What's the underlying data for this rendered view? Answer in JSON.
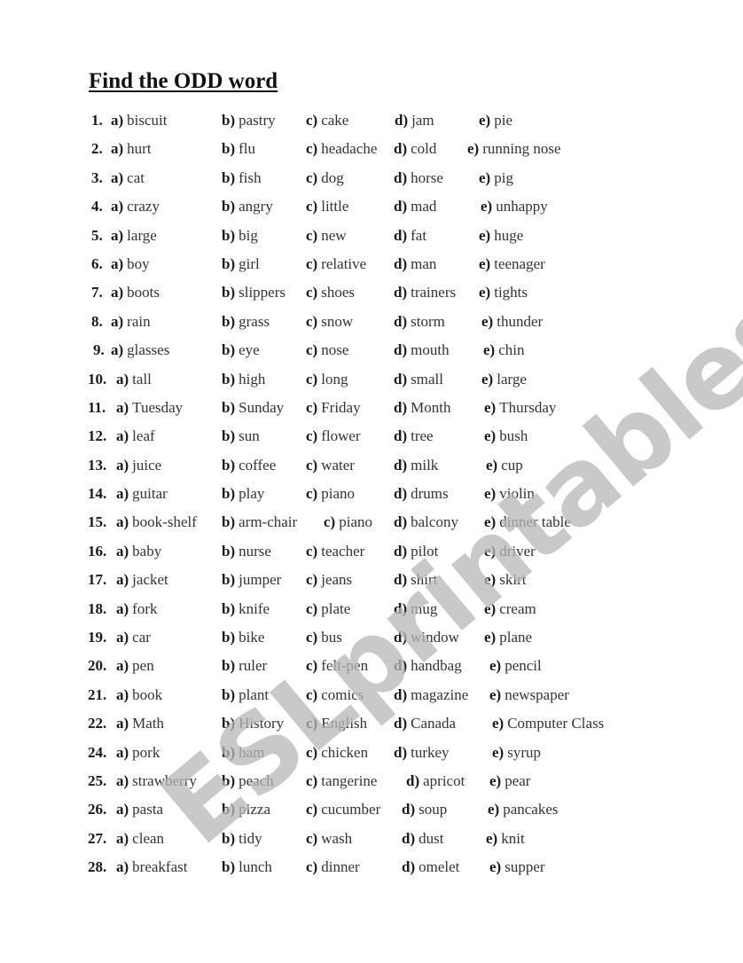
{
  "title": "Find the ODD word",
  "watermark": "ESLprintables.com",
  "colors": {
    "text": "#1a1a1a",
    "watermark": "#b8b8b8",
    "background": "#ffffff"
  },
  "letters": [
    "a)",
    "b)",
    "c)",
    "d)",
    "e)"
  ],
  "items": [
    {
      "num": "1.",
      "options": [
        "biscuit",
        "pastry",
        "cake",
        "jam",
        "pie"
      ]
    },
    {
      "num": "2.",
      "options": [
        "hurt",
        "flu",
        "headache",
        "cold",
        "running nose"
      ]
    },
    {
      "num": "3.",
      "options": [
        "cat",
        "fish",
        "dog",
        "horse",
        "pig"
      ]
    },
    {
      "num": "4.",
      "options": [
        "crazy",
        "angry",
        "little",
        "mad",
        "unhappy"
      ]
    },
    {
      "num": "5.",
      "options": [
        "large",
        "big",
        "new",
        "fat",
        "huge"
      ]
    },
    {
      "num": "6.",
      "options": [
        "boy",
        "girl",
        "relative",
        "man",
        "teenager"
      ]
    },
    {
      "num": "7.",
      "options": [
        "boots",
        "slippers",
        "shoes",
        "trainers",
        "tights"
      ]
    },
    {
      "num": "8.",
      "options": [
        "rain",
        "grass",
        "snow",
        "storm",
        "thunder"
      ]
    },
    {
      "num": "9.",
      "options": [
        "glasses",
        "eye",
        "nose",
        "mouth",
        "chin"
      ]
    },
    {
      "num": "10.",
      "options": [
        "tall",
        "high",
        "long",
        "small",
        "large"
      ]
    },
    {
      "num": "11.",
      "options": [
        "Tuesday",
        "Sunday",
        "Friday",
        "Month",
        "Thursday"
      ]
    },
    {
      "num": "12.",
      "options": [
        "leaf",
        "sun",
        "flower",
        "tree",
        "bush"
      ]
    },
    {
      "num": "13.",
      "options": [
        "juice",
        "coffee",
        "water",
        "milk",
        "cup"
      ]
    },
    {
      "num": "14.",
      "options": [
        "guitar",
        "play",
        "piano",
        "drums",
        "violin"
      ]
    },
    {
      "num": "15.",
      "options": [
        "book-shelf",
        "arm-chair",
        "piano",
        "balcony",
        "dinner table"
      ]
    },
    {
      "num": "16.",
      "options": [
        "baby",
        "nurse",
        "teacher",
        "pilot",
        "driver"
      ]
    },
    {
      "num": "17.",
      "options": [
        "jacket",
        "jumper",
        "jeans",
        "shirt",
        "skirt"
      ]
    },
    {
      "num": "18.",
      "options": [
        "fork",
        "knife",
        "plate",
        "mug",
        "cream"
      ]
    },
    {
      "num": "19.",
      "options": [
        "car",
        "bike",
        "bus",
        "window",
        "plane"
      ]
    },
    {
      "num": "20.",
      "options": [
        "pen",
        "ruler",
        "felt-pen",
        "handbag",
        "pencil"
      ]
    },
    {
      "num": "21.",
      "options": [
        "book",
        "plant",
        "comics",
        "magazine",
        "newspaper"
      ]
    },
    {
      "num": "22.",
      "options": [
        "Math",
        "History",
        "English",
        "Canada",
        "Computer Class"
      ]
    },
    {
      "num": "24.",
      "options": [
        "pork",
        "ham",
        "chicken",
        "turkey",
        "syrup"
      ]
    },
    {
      "num": "25.",
      "options": [
        "strawberry",
        "peach",
        "tangerine",
        "apricot",
        "pear"
      ]
    },
    {
      "num": "26.",
      "options": [
        "pasta",
        "pizza",
        "cucumber",
        "soup",
        "pancakes"
      ]
    },
    {
      "num": "27.",
      "options": [
        "clean",
        "tidy",
        "wash",
        "dust",
        "knit"
      ]
    },
    {
      "num": "28.",
      "options": [
        "breakfast",
        "lunch",
        "dinner",
        "omelet",
        "supper"
      ]
    }
  ]
}
